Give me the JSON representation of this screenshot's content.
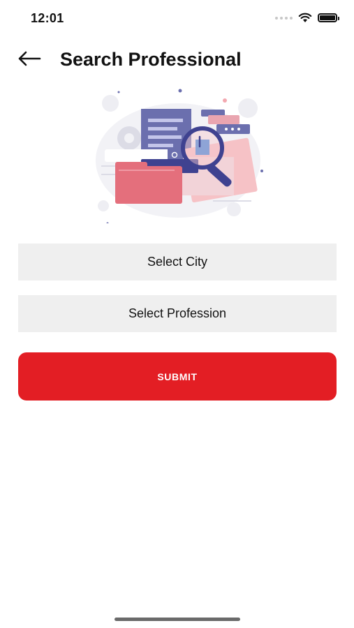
{
  "status_bar": {
    "time": "12:01"
  },
  "header": {
    "title": "Search Professional"
  },
  "form": {
    "city_label": "Select City",
    "profession_label": "Select Profession",
    "submit_label": "SUBMIT"
  },
  "colors": {
    "accent": "#e31e24",
    "field_bg": "#efefef"
  },
  "icons": {
    "back": "arrow-left-icon",
    "wifi": "wifi-icon",
    "battery": "battery-icon"
  }
}
